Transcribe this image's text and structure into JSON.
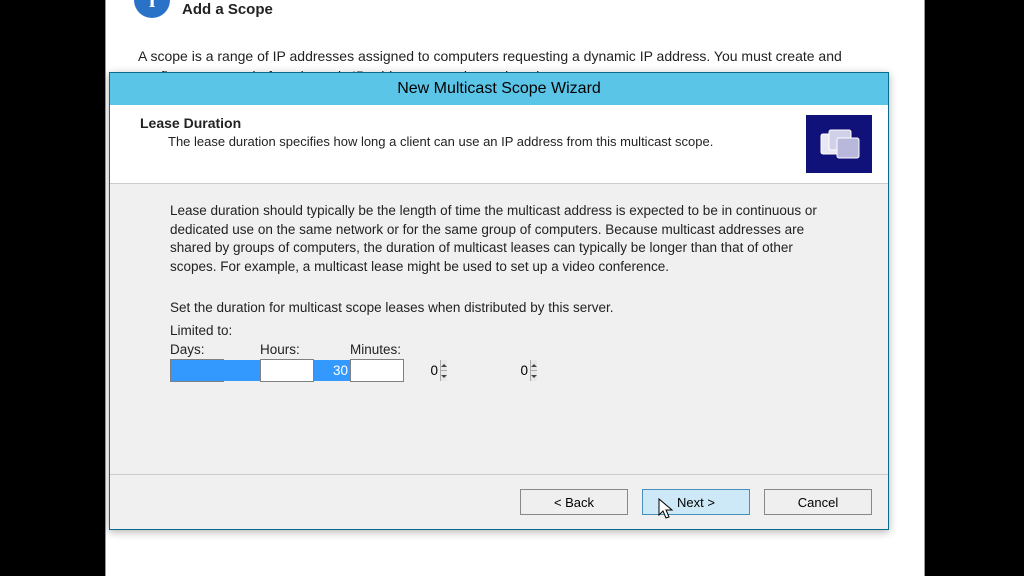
{
  "background": {
    "title": "Add a Scope",
    "description": "A scope is a range of IP addresses assigned to computers requesting a dynamic IP address. You must create and configure a scope before dynamic IP addresses can be assigned."
  },
  "dialog": {
    "title": "New Multicast Scope Wizard",
    "section_title": "Lease Duration",
    "section_sub": "The lease duration specifies how long a client can use an IP address from this multicast scope.",
    "para1": "Lease duration should typically be the length of time the multicast address is expected to be in continuous or dedicated use on the same network or for the same group of computers. Because multicast addresses are shared by groups of computers, the duration of multicast leases can typically be longer than that of other scopes. For example, a multicast lease might be used to set up a video conference.",
    "para2": "Set the duration for multicast scope leases when distributed by this server.",
    "limited_label": "Limited to:",
    "duration": {
      "days_label": "Days:",
      "hours_label": "Hours:",
      "minutes_label": "Minutes:",
      "days_value": "30",
      "hours_value": "0",
      "minutes_value": "0"
    },
    "back_label": "< Back",
    "next_label": "Next >",
    "cancel_label": "Cancel"
  }
}
